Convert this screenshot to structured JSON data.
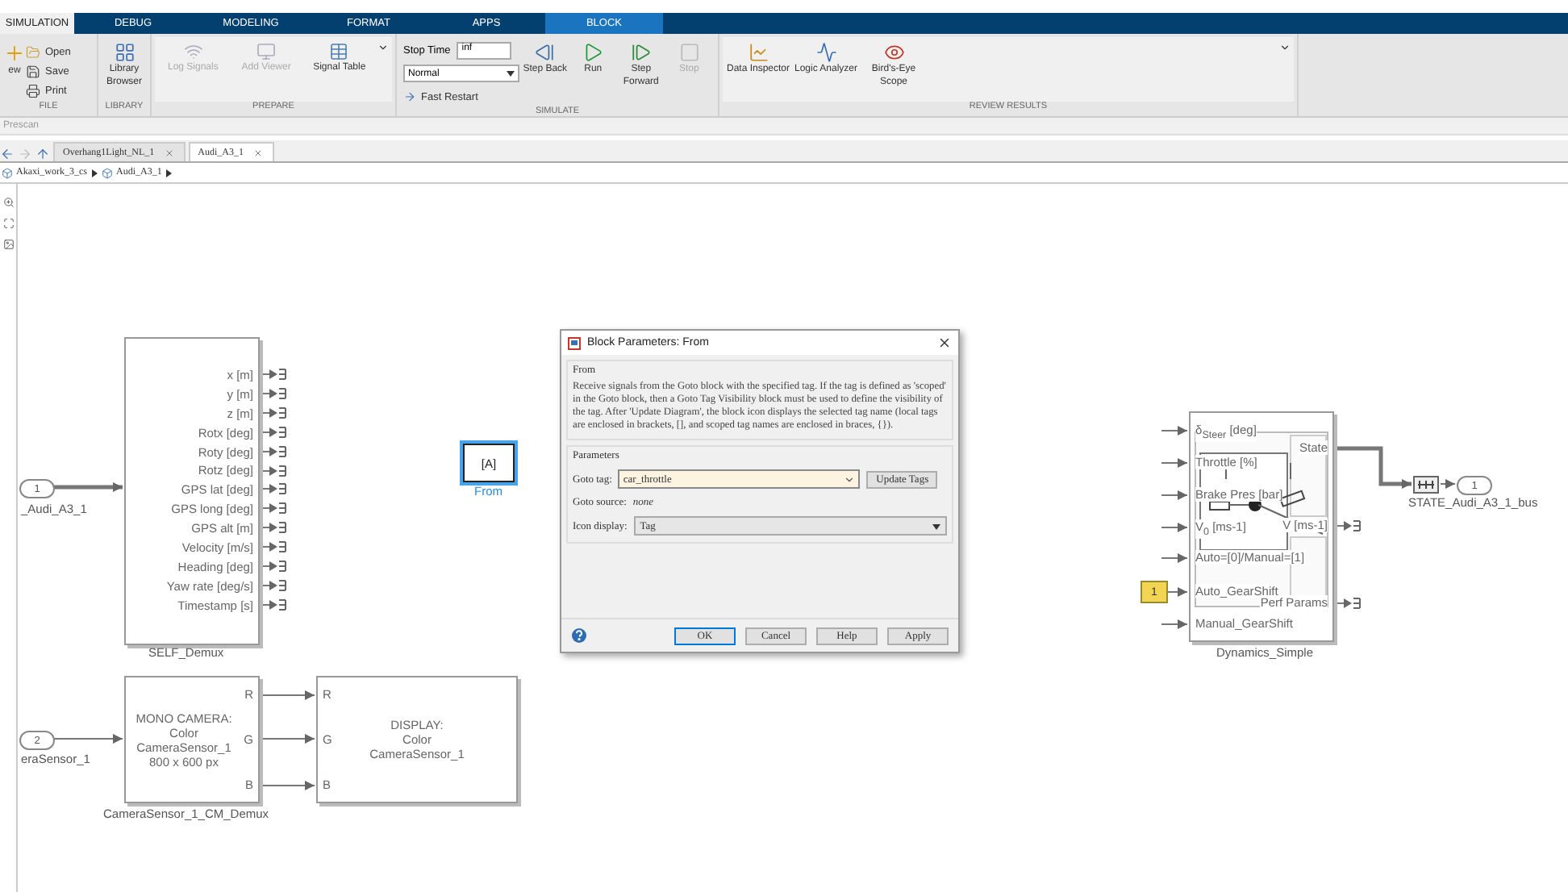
{
  "tabs": [
    {
      "label": "SIMULATION",
      "selected": true,
      "contextual": false
    },
    {
      "label": "DEBUG",
      "selected": false,
      "contextual": false
    },
    {
      "label": "MODELING",
      "selected": false,
      "contextual": false
    },
    {
      "label": "FORMAT",
      "selected": false,
      "contextual": false
    },
    {
      "label": "APPS",
      "selected": false,
      "contextual": false
    },
    {
      "label": "BLOCK",
      "selected": false,
      "contextual": true
    }
  ],
  "ribbon": {
    "file": {
      "label": "FILE",
      "new_label": "ew",
      "items": [
        {
          "kind": "open",
          "label": "Open"
        },
        {
          "kind": "save",
          "label": "Save"
        },
        {
          "kind": "print",
          "label": "Print"
        }
      ]
    },
    "library": {
      "label": "LIBRARY",
      "item": "Library Browser"
    },
    "prepare": {
      "label": "PREPARE",
      "items": [
        {
          "kind": "log",
          "label": "Log Signals",
          "disabled": true
        },
        {
          "kind": "viewer",
          "label": "Add Viewer",
          "disabled": true
        },
        {
          "kind": "table",
          "label": "Signal Table",
          "disabled": false
        }
      ]
    },
    "simulate": {
      "label": "SIMULATE",
      "stop_time_label": "Stop Time",
      "stop_time": "inf",
      "mode": "Normal",
      "fast_restart": "Fast Restart",
      "items": [
        {
          "kind": "back",
          "label": "Step Back",
          "disabled": false
        },
        {
          "kind": "run",
          "label": "Run",
          "disabled": false
        },
        {
          "kind": "forward",
          "label": "Step Forward",
          "disabled": false
        },
        {
          "kind": "stop",
          "label": "Stop",
          "disabled": true
        }
      ]
    },
    "review": {
      "label": "REVIEW RESULTS",
      "items": [
        {
          "kind": "inspector",
          "label": "Data Inspector"
        },
        {
          "kind": "logic",
          "label": "Logic Analyzer"
        },
        {
          "kind": "birdseye",
          "label": "Bird's-Eye Scope"
        }
      ]
    }
  },
  "prescan_bar": {
    "label": "Prescan"
  },
  "model_tabs": [
    {
      "label": "Overhang1Light_NL_1",
      "selected": false
    },
    {
      "label": "Audi_A3_1",
      "selected": true
    }
  ],
  "breadcrumb": [
    "Akaxi_work_3_cs",
    "Audi_A3_1"
  ],
  "canvas": {
    "inports": [
      {
        "number": "1",
        "label": "_Audi_A3_1"
      },
      {
        "number": "2",
        "label": "eraSensor_1"
      }
    ],
    "self_demux": {
      "name": "SELF_Demux",
      "outputs": [
        "x [m]",
        "y [m]",
        "z [m]",
        "Rotx [deg]",
        "Roty [deg]",
        "Rotz [deg]",
        "GPS lat [deg]",
        "GPS long [deg]",
        "GPS alt [m]",
        "Velocity [m/s]",
        "Heading [deg]",
        "Yaw rate [deg/s]",
        "Timestamp [s]"
      ]
    },
    "from_block": {
      "tag": "[A]",
      "label": "From",
      "selected": true
    },
    "camera_demux": {
      "name": "CameraSensor_1_CM_Demux",
      "text": "MONO CAMERA:\nColor\nCameraSensor_1\n800 x 600 px",
      "ports": [
        "R",
        "G",
        "B"
      ]
    },
    "display": {
      "text": "DISPLAY:\nColor\nCameraSensor_1",
      "ports": [
        "R",
        "G",
        "B"
      ]
    },
    "dynamics": {
      "name": "Dynamics_Simple",
      "inputs": [
        "δ$_{Steer}$ [deg]",
        "Throttle [%]",
        "Brake Pres [bar]",
        "V$_{0}$ [ms-1]",
        "Auto=[0]/Manual=[1]",
        "Auto_GearShift",
        "Manual_GearShift"
      ],
      "outputs": [
        "State",
        "V [ms-1]",
        "Perf Params"
      ]
    },
    "constant": {
      "value": "1"
    },
    "outport": {
      "number": "1",
      "label": "STATE_Audi_A3_1_bus"
    }
  },
  "dialog": {
    "title": "Block Parameters: From",
    "section": "From",
    "description": "Receive signals from the Goto block with the specified tag.  If the tag is defined as 'scoped' in the Goto block, then a Goto Tag Visibility block must be used to define the visibility of the tag. After 'Update Diagram', the block icon displays the selected tag name  (local tags are enclosed in brackets, [], and scoped tag names are enclosed in braces, {}).",
    "parameters_label": "Parameters",
    "goto_tag_label": "Goto tag:",
    "goto_tag": "car_throttle",
    "update_button": "Update Tags",
    "goto_source_label": "Goto source:",
    "goto_source": "none",
    "icon_display_label": "Icon display:",
    "icon_display": "Tag",
    "buttons": [
      "OK",
      "Cancel",
      "Help",
      "Apply"
    ]
  }
}
